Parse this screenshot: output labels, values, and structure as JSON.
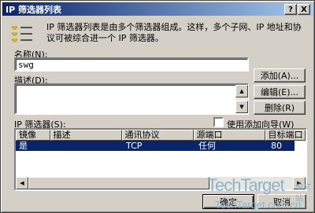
{
  "window": {
    "title": "IP 筛选器列表",
    "help_glyph": "?",
    "close_glyph": "X"
  },
  "info": {
    "icon": "filter-list-icon",
    "text": "IP 筛选器列表是由多个筛选器组成。这样，多个子网、IP 地址和协议可被综合进一个 IP 筛选器。"
  },
  "name_field": {
    "label": "名称(N):",
    "value": "swg"
  },
  "description_field": {
    "label": "描述(D):",
    "value": ""
  },
  "buttons": {
    "add": "添加(A)...",
    "edit": "编辑(E)...",
    "remove": "删除(R)",
    "ok": "确定",
    "cancel": "取消"
  },
  "filters": {
    "label": "IP 筛选器(S):",
    "wizard_checkbox_label": "使用添加向导(W)",
    "wizard_checked": false,
    "columns": [
      "镜像",
      "描述",
      "通讯协议",
      "源端口",
      "目标端口"
    ],
    "rows": [
      {
        "mirrored": "是",
        "description": "",
        "protocol": "TCP",
        "source_port": "任何",
        "dest_port": "80"
      }
    ]
  },
  "watermark": {
    "brand": "TechTarget",
    "cn": "中文站",
    "url": "TechTarget.com.cn"
  },
  "colors": {
    "titlebar_start": "#0a246a",
    "titlebar_end": "#a6caf0",
    "selection": "#0a246a",
    "face": "#d4d0c8"
  }
}
